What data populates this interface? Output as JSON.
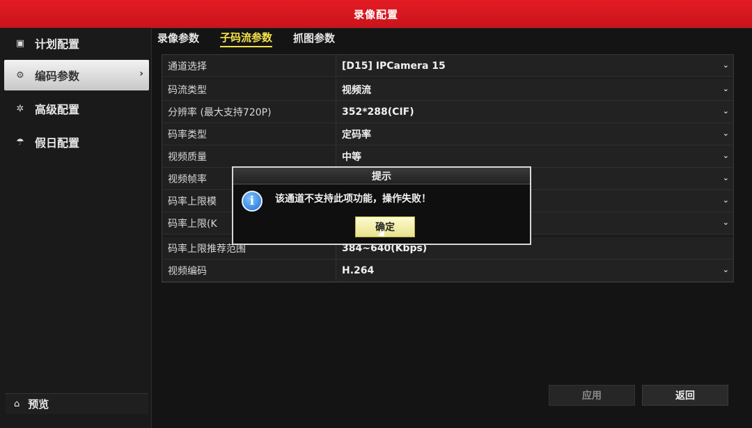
{
  "window": {
    "title": "录像配置"
  },
  "sidebar": {
    "items": [
      {
        "label": "计划配置",
        "icon": "calendar-icon"
      },
      {
        "label": "编码参数",
        "icon": "gear-icon",
        "active": true
      },
      {
        "label": "高级配置",
        "icon": "advanced-gear-icon"
      },
      {
        "label": "假日配置",
        "icon": "holiday-icon"
      }
    ],
    "preview_label": "预览"
  },
  "tabs": [
    {
      "label": "录像参数"
    },
    {
      "label": "子码流参数",
      "active": true
    },
    {
      "label": "抓图参数"
    }
  ],
  "form": {
    "rows": [
      {
        "label": "通道选择",
        "value": "[D15] IPCamera 15"
      },
      {
        "label": "码流类型",
        "value": "视频流"
      },
      {
        "label": "分辨率 (最大支持720P)",
        "value": "352*288(CIF)"
      },
      {
        "label": "码率类型",
        "value": "定码率"
      },
      {
        "label": "视频质量",
        "value": "中等"
      },
      {
        "label": "视频帧率",
        "value": ""
      },
      {
        "label": "码率上限模",
        "value": ""
      },
      {
        "label": "码率上限(K",
        "value": ""
      },
      {
        "label": "码率上限推荐范围",
        "value": "384~640(Kbps)"
      },
      {
        "label": "视频编码",
        "value": "H.264"
      }
    ]
  },
  "buttons": {
    "apply": "应用",
    "back": "返回"
  },
  "dialog": {
    "title": "提示",
    "message": "该通道不支持此项功能，操作失败！",
    "ok": "确定"
  },
  "colors": {
    "titlebar": "#e31b23",
    "active_tab": "#f5e24a",
    "ok_button": "#efe99a"
  }
}
